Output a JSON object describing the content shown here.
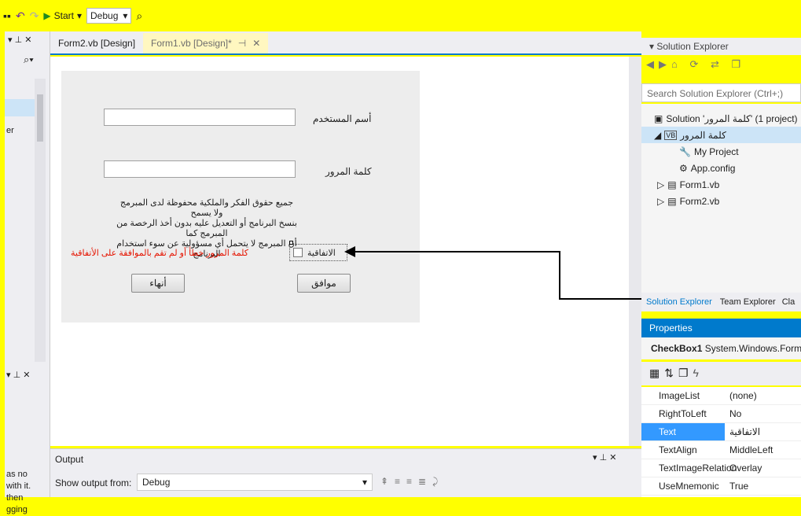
{
  "toolbar": {
    "start_label": "Start",
    "config_value": "Debug"
  },
  "tabs": [
    {
      "label": "Form2.vb [Design]"
    },
    {
      "label": "Form1.vb [Design]*"
    }
  ],
  "left_panel": {
    "text_lines": [
      "er",
      "as no",
      "with it.",
      "then",
      "gging"
    ]
  },
  "form": {
    "username_label": "أسم المستخدم",
    "password_label": "كلمة المرور",
    "notice_lines": [
      "جميع حقوق الفكر والملكية محفوظة لدى المبرمج ولا يسمح",
      "بنسخ البرنامج أو التعديل عليه بدون أخذ الرخصة من المبرمج كما",
      "أن المبرمج لا يتحمل أي مسؤولية عن سوء استخدام البرنامج"
    ],
    "error_text": "كلمة المرور خطأ أو لم تقم بالموافقة على الأتفاقية",
    "checkbox_label": "الاتفاقية",
    "ok_button": "موافق",
    "exit_button": "أنهاء"
  },
  "output": {
    "title": "Output",
    "show_from_label": "Show output from:",
    "source_value": "Debug"
  },
  "solution_explorer": {
    "title": "Solution Explorer",
    "search_placeholder": "Search Solution Explorer (Ctrl+;)",
    "items": [
      {
        "label": "Solution 'كلمة المرور' (1 project)"
      },
      {
        "label": "كلمة المرور"
      },
      {
        "label": "My Project"
      },
      {
        "label": "App.config"
      },
      {
        "label": "Form1.vb"
      },
      {
        "label": "Form2.vb"
      }
    ],
    "bottom_tabs": [
      "Solution Explorer",
      "Team Explorer",
      "Cla"
    ]
  },
  "properties": {
    "title": "Properties",
    "object_name": "CheckBox1",
    "object_type": "System.Windows.Forms.C",
    "rows": [
      {
        "name": "ImageList",
        "value": "(none)"
      },
      {
        "name": "RightToLeft",
        "value": "No"
      },
      {
        "name": "Text",
        "value": "الاتفاقية"
      },
      {
        "name": "TextAlign",
        "value": "MiddleLeft"
      },
      {
        "name": "TextImageRelation",
        "value": "Overlay"
      },
      {
        "name": "UseMnemonic",
        "value": "True"
      }
    ]
  },
  "colors": {
    "accent": "#007acc",
    "selection": "#3399ff",
    "error_text": "#e51400",
    "highlight": "#ffff00"
  }
}
